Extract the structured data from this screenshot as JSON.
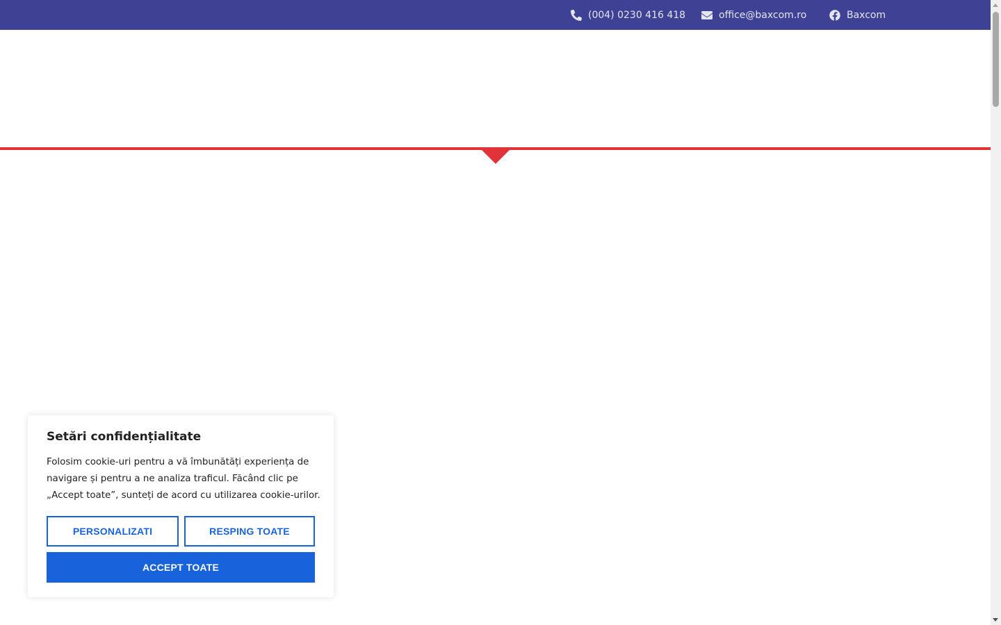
{
  "topbar": {
    "phone": {
      "icon": "phone-icon",
      "text": "(004) 0230 416 418"
    },
    "email": {
      "icon": "envelope-icon",
      "text": "office@baxcom.ro"
    },
    "facebook": {
      "icon": "facebook-icon",
      "text": "Baxcom"
    }
  },
  "cookie_banner": {
    "title": "Setări confidențialitate",
    "text": "Folosim cookie-uri pentru a vă îmbunătăți experiența de navigare și pentru a ne analiza traficul. Făcând clic pe „Accept toate”, sunteți de acord cu utilizarea cookie-urilor.",
    "customize_label": "PERSONALIZATI",
    "reject_label": "RESPING TOATE",
    "accept_label": "ACCEPT TOATE"
  },
  "colors": {
    "topbar_bg": "#3f4194",
    "accent_red": "#e0333a",
    "button_blue": "#1863dc"
  }
}
